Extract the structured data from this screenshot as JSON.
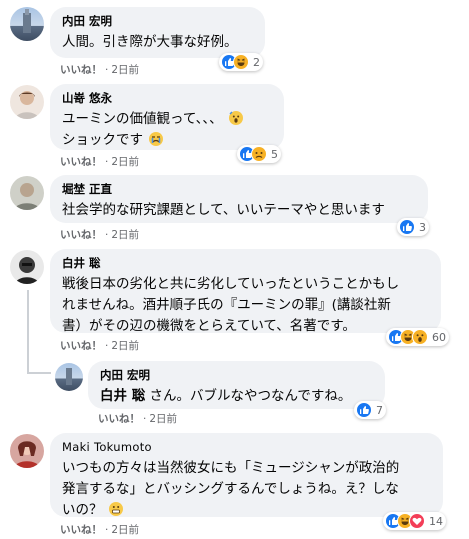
{
  "comments": [
    {
      "author": "内田 宏明",
      "text": "人間。引き際が大事な好例。",
      "like_label": "いいね！",
      "time": "2日前",
      "reactions": [
        "like-icon",
        "haha-icon"
      ],
      "reaction_count": "2"
    },
    {
      "author": "山嵜 悠永",
      "text_line1": "ユーミンの価値観って、、、",
      "text_line2": "ショックです",
      "like_label": "いいね！",
      "time": "2日前",
      "reactions": [
        "like-icon",
        "sad-icon"
      ],
      "reaction_count": "5"
    },
    {
      "author": "堀埜 正直",
      "text": "社会学的な研究課題として、いいテーマやと思います",
      "like_label": "いいね！",
      "time": "2日前",
      "reactions": [
        "like-icon"
      ],
      "reaction_count": "3"
    },
    {
      "author": "白井 聡",
      "text_line1": "戦後日本の劣化と共に劣化していったということかもし",
      "text_line2": "れませんね。酒井順子氏の『ユーミンの罪』(講談社新",
      "text_line3": "書）がその辺の機微をとらえていて、名著です。",
      "like_label": "いいね！",
      "time": "2日前",
      "reactions": [
        "like-icon",
        "haha-icon",
        "wow-icon"
      ],
      "reaction_count": "60"
    },
    {
      "author": "内田 宏明",
      "mention": "白井 聡",
      "text": "さん。バブルなやつなんですね。",
      "like_label": "いいね！",
      "time": "2日前",
      "reactions": [
        "like-icon"
      ],
      "reaction_count": "7"
    },
    {
      "author": "Maki Tokumoto",
      "text_line1": "いつもの方々は当然彼女にも「ミュージシャンが政治的",
      "text_line2": "発言するな」とバッシングするんでしょうね。え？しな",
      "text_line3": "いの？",
      "like_label": "いいね！",
      "time": "2日前",
      "reactions": [
        "like-icon",
        "haha-icon",
        "love-icon"
      ],
      "reaction_count": "14"
    }
  ],
  "separator": "·",
  "colors": {
    "bubble": "#f0f2f5",
    "meta": "#65676b",
    "like_blue": "#1877f2",
    "love": "#f33e58",
    "yellow": "#f7b125"
  }
}
